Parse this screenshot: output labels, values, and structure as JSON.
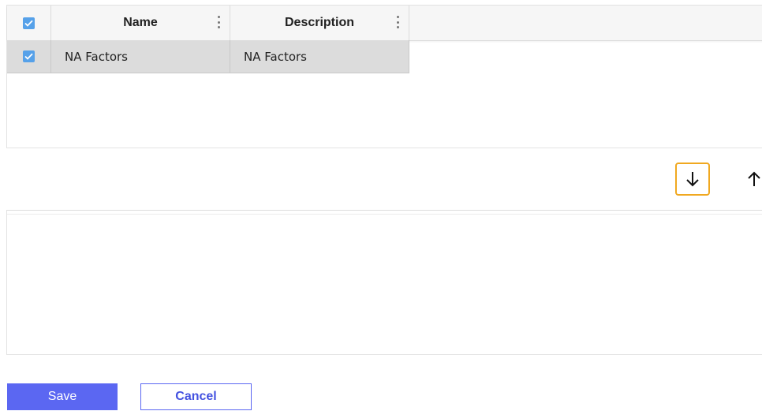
{
  "grid": {
    "columns": [
      {
        "label": "Name"
      },
      {
        "label": "Description"
      }
    ],
    "header_checkbox_checked": true,
    "rows": [
      {
        "checked": true,
        "name": "NA Factors",
        "description": "NA Factors"
      }
    ]
  },
  "arrows": {
    "down_icon": "arrow-down-icon",
    "up_icon": "arrow-up-icon"
  },
  "footer": {
    "save_label": "Save",
    "cancel_label": "Cancel"
  },
  "colors": {
    "accent": "#5b67f2",
    "checkbox": "#56a1e9",
    "focus_outline": "#f0a820",
    "row_selected": "#dcdcdc"
  }
}
